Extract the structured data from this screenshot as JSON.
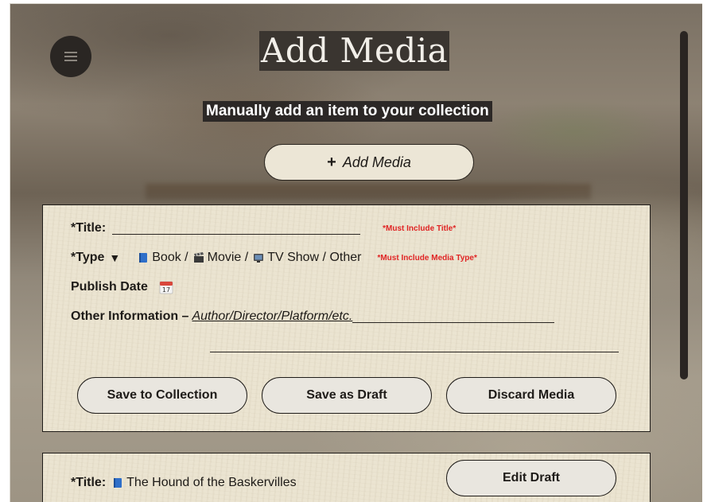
{
  "page": {
    "title": "Add Media",
    "subtitle": "Manually add an item to your collection"
  },
  "add_media_button": {
    "icon": "plus-icon",
    "label": "Add Media",
    "plus": "+"
  },
  "form": {
    "title_label": "*Title:",
    "title_warning": "*Must Include Title*",
    "type_label": "*Type",
    "type_arrow": "▼",
    "type_options": [
      {
        "icon": "book-icon",
        "label": "Book /"
      },
      {
        "icon": "clapperboard-icon",
        "label": "Movie /"
      },
      {
        "icon": "tv-icon",
        "label": "TV Show / Other"
      }
    ],
    "type_warning": "*Must Include Media Type*",
    "publish_date_label": "Publish Date",
    "calendar_day": "17",
    "other_info_label": "Other Information –",
    "other_info_placeholder": "Author/Director/Platform/etc."
  },
  "actions": {
    "save_to_collection": "Save to Collection",
    "save_as_draft": "Save as Draft",
    "discard_media": "Discard Media"
  },
  "draft": {
    "title_label": "*Title:",
    "title_value": "The Hound of the Baskervilles",
    "edit_button": "Edit Draft"
  },
  "colors": {
    "card_bg": "#ebe4d1",
    "warning": "#e02424",
    "dark": "#2a2623"
  }
}
